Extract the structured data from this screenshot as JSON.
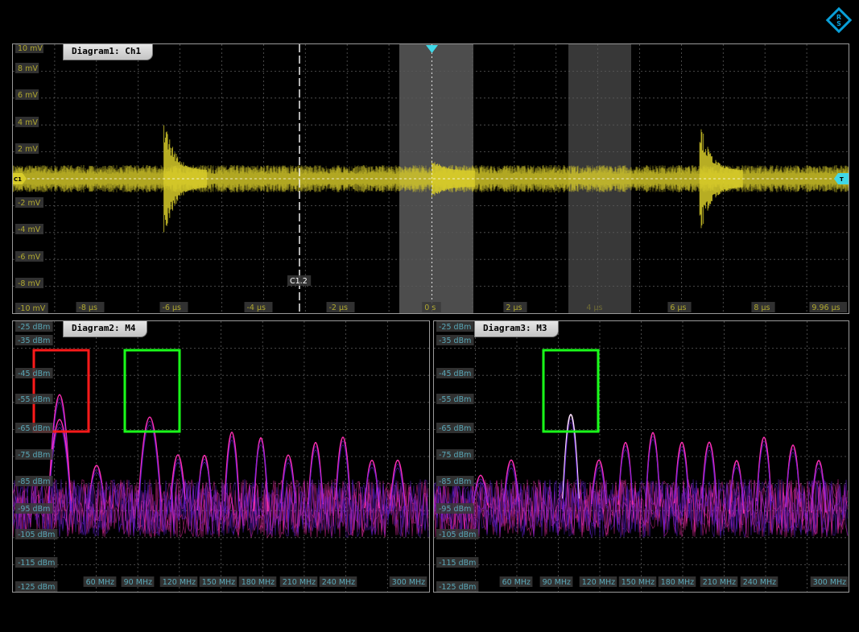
{
  "colors": {
    "ch1_trace": "#d8cc2a",
    "spectrum_pink": "#ff2fb4",
    "spectrum_purple": "#6a20e0",
    "grid": "#5a5a5a",
    "label_text": "#b0a830",
    "freq_label_text": "#5aa8b8",
    "label_box": "#3a3a3a",
    "marker_red": "#ff1a1a",
    "marker_green": "#1aff1a",
    "gate_window": "#8c8c8c",
    "trigger_marker": "#40d8e8",
    "logo": "#0a9fd8"
  },
  "logo_icon": "rohde-schwarz-logo-icon",
  "diagram1": {
    "title": "Diagram1: Ch1",
    "cursor_label": "C1.2",
    "channel_marker": "C1",
    "trigger_marker": "T",
    "y_labels": [
      "10 mV",
      "8 mV",
      "6 mV",
      "4 mV",
      "2 mV",
      "-2 mV",
      "-4 mV",
      "-6 mV",
      "-8 mV",
      "-10 mV"
    ],
    "x_labels": [
      "-8 µs",
      "-6 µs",
      "-4 µs",
      "-2 µs",
      "0 s",
      "2 µs",
      "4 µs",
      "6 µs",
      "8 µs",
      "9.96 µs"
    ]
  },
  "diagram2": {
    "title": "Diagram2: M4",
    "y_labels": [
      "-25 dBm",
      "-35 dBm",
      "-45 dBm",
      "-55 dBm",
      "-65 dBm",
      "-75 dBm",
      "-85 dBm",
      "-95 dBm",
      "-105 dBm",
      "-115 dBm",
      "-125 dBm"
    ],
    "x_labels": [
      "60 MHz",
      "90 MHz",
      "120 MHz",
      "150 MHz",
      "180 MHz",
      "210 MHz",
      "240 MHz",
      "300 MHz"
    ]
  },
  "diagram3": {
    "title": "Diagram3: M3",
    "y_labels": [
      "-25 dBm",
      "-35 dBm",
      "-45 dBm",
      "-55 dBm",
      "-65 dBm",
      "-75 dBm",
      "-85 dBm",
      "-95 dBm",
      "-105 dBm",
      "-115 dBm",
      "-125 dBm"
    ],
    "x_labels": [
      "60 MHz",
      "90 MHz",
      "120 MHz",
      "150 MHz",
      "180 MHz",
      "210 MHz",
      "240 MHz",
      "300 MHz"
    ]
  }
}
